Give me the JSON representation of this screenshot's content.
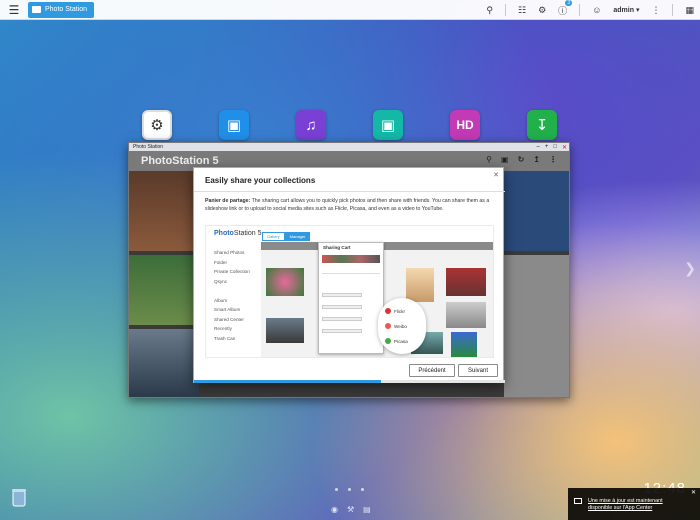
{
  "topbar": {
    "tab_label": "Photo Station",
    "user": "admin",
    "info_badge": "3"
  },
  "desktop": {
    "dots_count": 3,
    "clock": "12:48"
  },
  "window": {
    "title": "Photo Station",
    "app_name": "PhotoStation 5",
    "tabs": [
      "Gallery",
      "Manager"
    ]
  },
  "modal": {
    "title": "Easily share your collections",
    "lead": "Panier de partage:",
    "body": " The sharing cart allows you to quickly pick photos and then share with friends. You can share them as a slideshow link or to upload to social media sites such as Flickr, Picasa, and even as a video to YouTube.",
    "prev_button": "Précédent",
    "next_button": "Suivant",
    "progress": 0.6
  },
  "inner": {
    "logo_a": "Photo",
    "logo_b": "Station 5",
    "tabs": [
      "Gallery",
      "Manager"
    ],
    "side_items": [
      "Shared Photos",
      "Folder",
      "Private Collection",
      "Qsync",
      "",
      "Album",
      "Smart Album",
      "Shared Center",
      "Recently",
      "Trash Can"
    ],
    "cart_title": "Sharing Cart",
    "share_items": [
      "Flickr",
      "Weibo",
      "Picasa"
    ]
  },
  "notification": {
    "line1": "Une mise à jour est maintenant",
    "line2": "disponible sur l'App Center"
  },
  "colors": {
    "accent": "#2f9ae0"
  }
}
